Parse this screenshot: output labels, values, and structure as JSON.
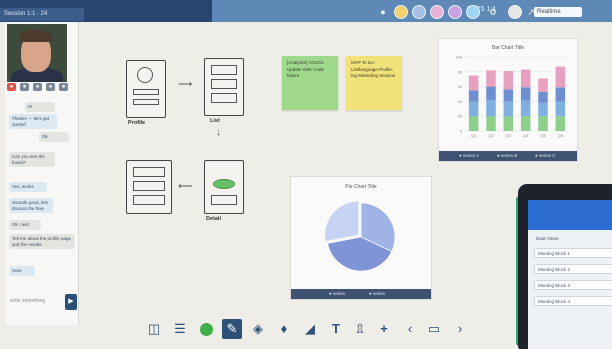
{
  "topbar": {
    "left_tab": "Session 1:1 · 24",
    "zoom": "Fit  75  1:1",
    "board_name": "Realtime",
    "avatar_colors": [
      "#f0d36a",
      "#a7c0e6",
      "#e7b2d6",
      "#c7a3e6",
      "#9fd7f2",
      "#e6e6e6"
    ]
  },
  "chat": {
    "messages": [
      {
        "dir": "out",
        "text": "Hi"
      },
      {
        "dir": "in",
        "text": "Thanks — let's get started"
      },
      {
        "dir": "out",
        "text": "Ok"
      },
      {
        "dir": "out",
        "text": "Can you see the board?"
      },
      {
        "dir": "in",
        "text": "Yes, works"
      },
      {
        "dir": "in",
        "text": "Sounds good, lets discuss the flow"
      },
      {
        "dir": "out",
        "text": "Ok, next"
      },
      {
        "dir": "out",
        "text": "Tell me about the profile page and the results"
      },
      {
        "dir": "in",
        "text": "Sure"
      }
    ],
    "input_placeholder": "write something",
    "send_icon": "send-icon"
  },
  "whiteboard": {
    "sketch_labels": {
      "profile": "Profile",
      "list": "List",
      "detail": "Detail"
    },
    "sticky_green": "[Analytics] 7/10/21 Update SDK Code failure",
    "sticky_yellow": "MVP To Do: List/language Profile, log Marketing Session"
  },
  "bar_card": {
    "footer": [
      "● series A",
      "● series B",
      "● series C"
    ],
    "colors": [
      "#8fcf8c",
      "#7fb0e0",
      "#6f8fd0",
      "#e8a0c0"
    ]
  },
  "pie_card": {
    "footer": [
      "● series",
      "● series"
    ],
    "colors": [
      "#9fb3e6",
      "#7f93d6",
      "#c6d3f2"
    ]
  },
  "chart_data": [
    {
      "type": "bar",
      "title": "Bar Chart Title",
      "categories": [
        "Q1",
        "Q2",
        "Q3",
        "Q4",
        "Q5",
        "Q6"
      ],
      "series": [
        {
          "values": [
            20,
            20,
            20,
            20,
            20,
            20
          ]
        },
        {
          "values": [
            20,
            22,
            20,
            21,
            18,
            20
          ]
        },
        {
          "values": [
            15,
            18,
            16,
            18,
            15,
            19
          ]
        },
        {
          "values": [
            20,
            22,
            25,
            24,
            18,
            28
          ]
        }
      ],
      "ylim": [
        0,
        100
      ],
      "grid": true,
      "legend": "bottom"
    },
    {
      "type": "pie",
      "title": "Pie Chart Title",
      "values": [
        32,
        40,
        28
      ]
    }
  ],
  "toolbar": {
    "tools": [
      "layers-icon",
      "menu-icon",
      "color-icon",
      "pen-icon",
      "eraser-icon",
      "marker-icon",
      "sticky-note-icon",
      "text-icon",
      "upload-icon",
      "add-icon",
      "back-icon",
      "screen-icon",
      "forward-icon"
    ]
  },
  "tablet": {
    "label": "Data Views",
    "rows": [
      "Meeting Block 1",
      "Meeting Block 2",
      "Meeting Block 3",
      "Meeting Block 4"
    ]
  }
}
